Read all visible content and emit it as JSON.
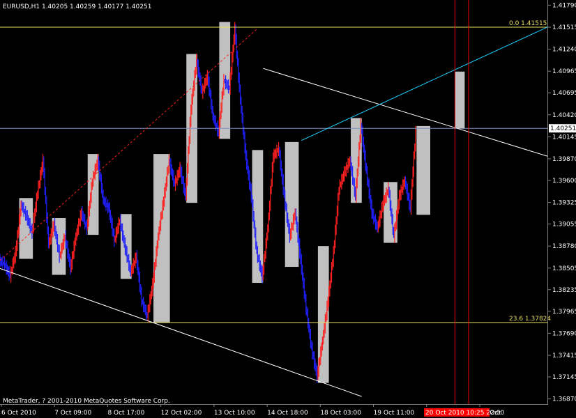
{
  "header": {
    "title": "EURUSD,H1  1.40205 1.40259 1.40177 1.40251"
  },
  "copyright": "MetaTrader, ? 2001-2010 MetaQuotes Software Corp.",
  "chart_data": {
    "type": "candlestick",
    "symbol": "EURUSD",
    "timeframe": "H1",
    "ohlc_last": {
      "open": 1.40205,
      "high": 1.40259,
      "low": 1.40177,
      "close": 1.40251
    },
    "y_ticks": [
      1.4179,
      1.41515,
      1.4124,
      1.40965,
      1.40695,
      1.4042,
      1.40145,
      1.3987,
      1.396,
      1.39325,
      1.39055,
      1.3878,
      1.38505,
      1.38235,
      1.37965,
      1.3769,
      1.37415,
      1.37145,
      1.3687
    ],
    "ylim": [
      1.3684,
      1.4182
    ],
    "x_ticks": [
      "6 Oct 2010",
      "7 Oct 09:00",
      "8 Oct 17:00",
      "12 Oct 02:00",
      "13 Oct 10:00",
      "14 Oct 18:00",
      "18 Oct 03:00",
      "19 Oct 11:00",
      "20 Oct 19:00",
      "22 Oct"
    ],
    "x_highlight_label": "20 Oct 2010 10:25 22:00",
    "current_price": "1.40251",
    "fibonacci": [
      {
        "level": "0.0",
        "price": 1.41515
      },
      {
        "level": "23.6",
        "price": 1.37824
      }
    ],
    "colors": {
      "background": "#000000",
      "bull": "#ff2020",
      "bear": "#2020ff",
      "session_box": "#c0c0c0",
      "fib": "#e8e060",
      "trendline": "#ffffff",
      "channel": "#20d0ff",
      "vline": "#ff0000"
    },
    "series": [
      {
        "type": "price_path",
        "points": [
          [
            0.0,
            1.386
          ],
          [
            0.01,
            1.3855
          ],
          [
            0.02,
            1.384
          ],
          [
            0.03,
            1.387
          ],
          [
            0.04,
            1.393
          ],
          [
            0.05,
            1.3915
          ],
          [
            0.06,
            1.3895
          ],
          [
            0.07,
            1.3945
          ],
          [
            0.08,
            1.3985
          ],
          [
            0.09,
            1.388
          ],
          [
            0.1,
            1.3905
          ],
          [
            0.11,
            1.3865
          ],
          [
            0.12,
            1.389
          ],
          [
            0.13,
            1.385
          ],
          [
            0.14,
            1.389
          ],
          [
            0.15,
            1.392
          ],
          [
            0.16,
            1.39
          ],
          [
            0.17,
            1.396
          ],
          [
            0.18,
            1.3985
          ],
          [
            0.19,
            1.3935
          ],
          [
            0.2,
            1.3925
          ],
          [
            0.21,
            1.3885
          ],
          [
            0.22,
            1.391
          ],
          [
            0.23,
            1.3875
          ],
          [
            0.24,
            1.3845
          ],
          [
            0.25,
            1.3865
          ],
          [
            0.26,
            1.381
          ],
          [
            0.27,
            1.379
          ],
          [
            0.28,
            1.383
          ],
          [
            0.29,
            1.389
          ],
          [
            0.3,
            1.3935
          ],
          [
            0.31,
            1.3985
          ],
          [
            0.32,
            1.3955
          ],
          [
            0.33,
            1.3975
          ],
          [
            0.34,
            1.394
          ],
          [
            0.35,
            1.405
          ],
          [
            0.36,
            1.411
          ],
          [
            0.37,
            1.407
          ],
          [
            0.38,
            1.409
          ],
          [
            0.39,
            1.404
          ],
          [
            0.4,
            1.402
          ],
          [
            0.41,
            1.4085
          ],
          [
            0.42,
            1.4075
          ],
          [
            0.43,
            1.415
          ],
          [
            0.44,
            1.406
          ],
          [
            0.45,
            1.399
          ],
          [
            0.46,
            1.394
          ],
          [
            0.47,
            1.387
          ],
          [
            0.48,
            1.384
          ],
          [
            0.49,
            1.39
          ],
          [
            0.5,
            1.399
          ],
          [
            0.51,
            1.4
          ],
          [
            0.52,
            1.394
          ],
          [
            0.53,
            1.389
          ],
          [
            0.54,
            1.392
          ],
          [
            0.55,
            1.386
          ],
          [
            0.56,
            1.38
          ],
          [
            0.57,
            1.375
          ],
          [
            0.58,
            1.3715
          ],
          [
            0.59,
            1.376
          ],
          [
            0.6,
            1.381
          ],
          [
            0.61,
            1.387
          ],
          [
            0.62,
            1.395
          ],
          [
            0.63,
            1.397
          ],
          [
            0.64,
            1.3985
          ],
          [
            0.65,
            1.394
          ],
          [
            0.66,
            1.403
          ],
          [
            0.67,
            1.397
          ],
          [
            0.68,
            1.392
          ],
          [
            0.69,
            1.39
          ],
          [
            0.7,
            1.393
          ],
          [
            0.71,
            1.395
          ],
          [
            0.72,
            1.389
          ],
          [
            0.73,
            1.394
          ],
          [
            0.74,
            1.396
          ],
          [
            0.75,
            1.3925
          ],
          [
            0.76,
            1.402
          ]
        ]
      }
    ]
  }
}
